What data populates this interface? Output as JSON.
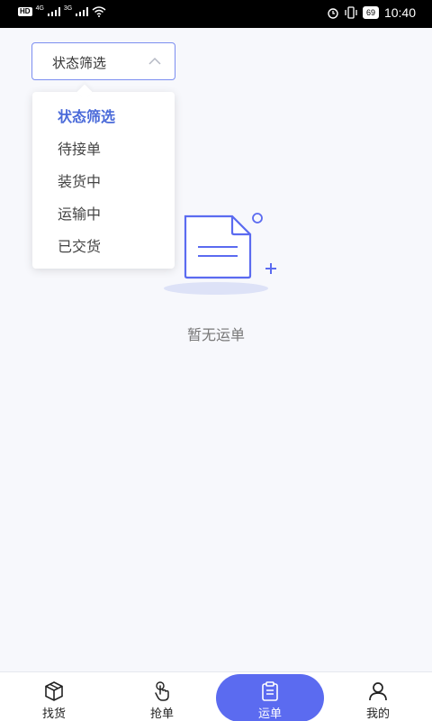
{
  "status_bar": {
    "left_badge": "HD",
    "net1": "4G",
    "net2": "3G",
    "battery": "69",
    "time": "10:40"
  },
  "filter": {
    "selected": "状态筛选",
    "options": [
      "状态筛选",
      "待接单",
      "装货中",
      "运输中",
      "已交货"
    ]
  },
  "empty_state": {
    "text": "暂无运单"
  },
  "tabs": [
    {
      "label": "找货",
      "icon": "box-icon"
    },
    {
      "label": "抢单",
      "icon": "hand-tap-icon"
    },
    {
      "label": "运单",
      "icon": "clipboard-icon",
      "active": true
    },
    {
      "label": "我的",
      "icon": "user-icon"
    }
  ],
  "colors": {
    "accent": "#5b6bf0",
    "active_option": "#4a6ad9",
    "background": "#f7f8fc"
  }
}
